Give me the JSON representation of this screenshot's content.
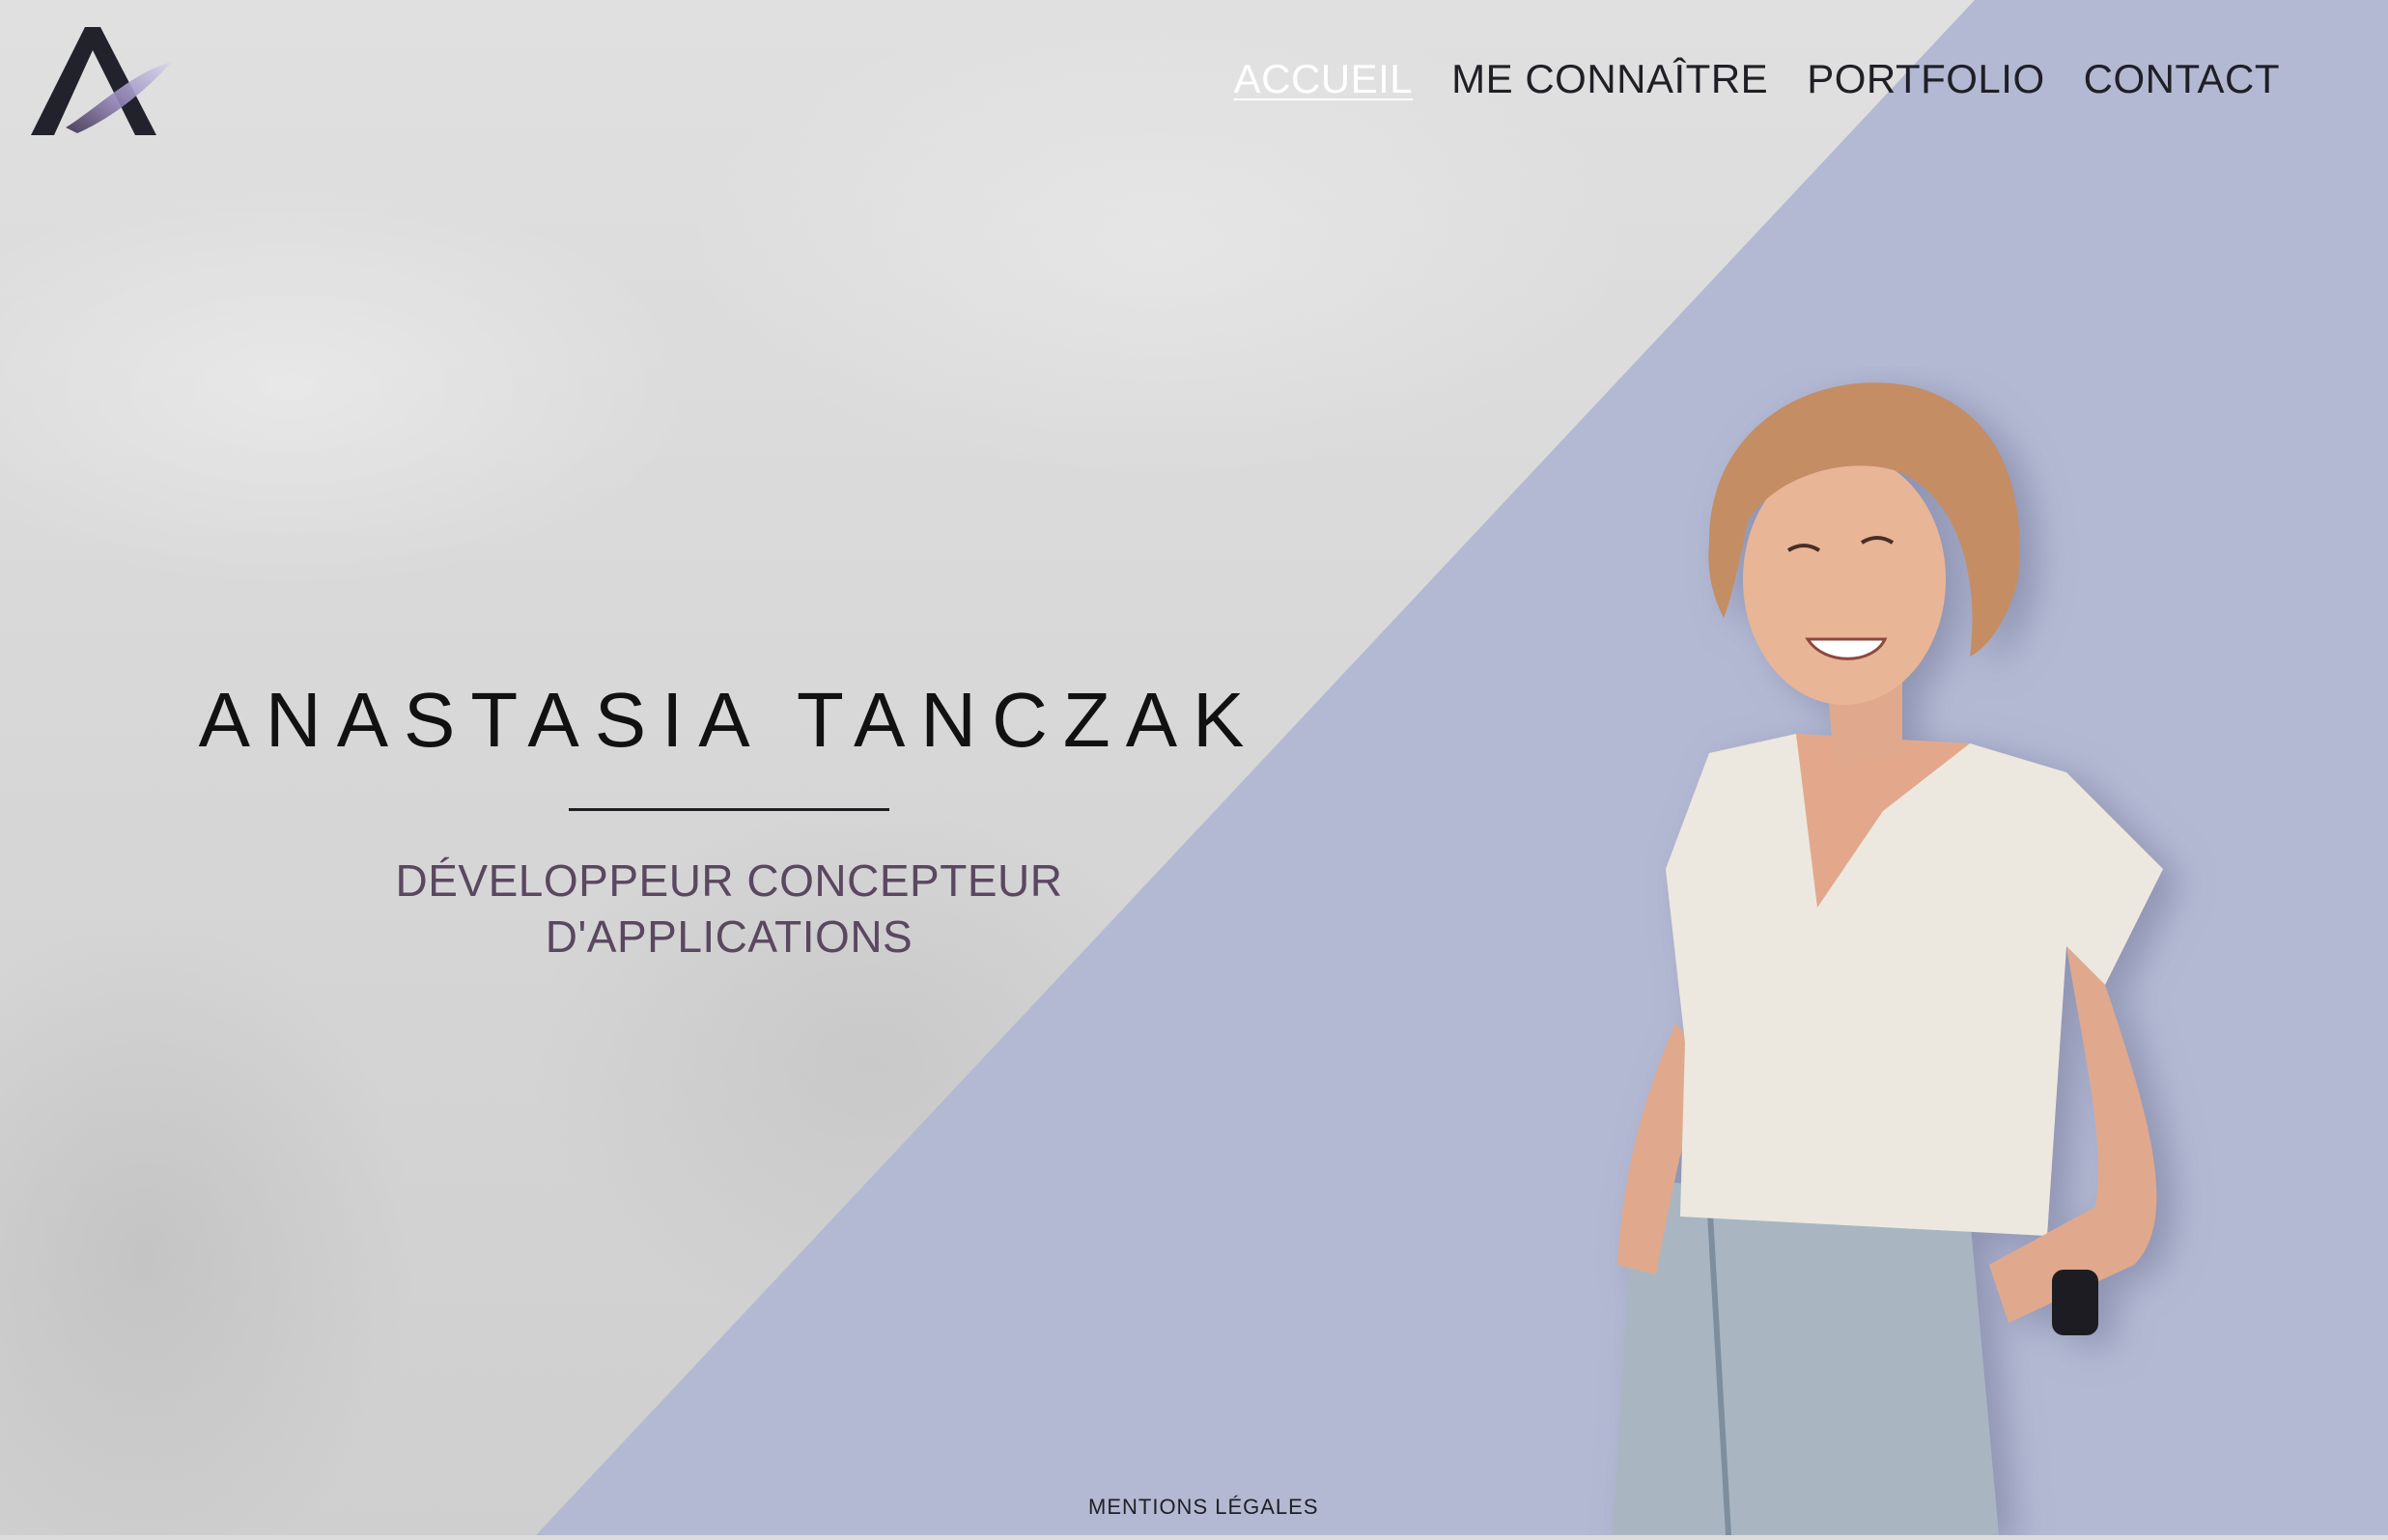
{
  "nav": {
    "items": [
      {
        "label": "ACCUEIL",
        "active": true
      },
      {
        "label": "ME CONNAÎTRE",
        "active": false
      },
      {
        "label": "PORTFOLIO",
        "active": false
      },
      {
        "label": "CONTACT",
        "active": false
      }
    ]
  },
  "hero": {
    "name": "ANASTASIA TANCZAK",
    "role_line1": "DÉVELOPPEUR CONCEPTEUR",
    "role_line2": "D'APPLICATIONS"
  },
  "footer": {
    "legal_link": "MENTIONS LÉGALES"
  },
  "colors": {
    "lavender_panel": "#b3b9d3",
    "gray_panel": "#dcdcdc",
    "role_text": "#5a4760",
    "nav_text": "#1f1f26",
    "nav_active": "#ffffff"
  },
  "icons": {
    "logo": "stylized-letter-a-logo"
  }
}
